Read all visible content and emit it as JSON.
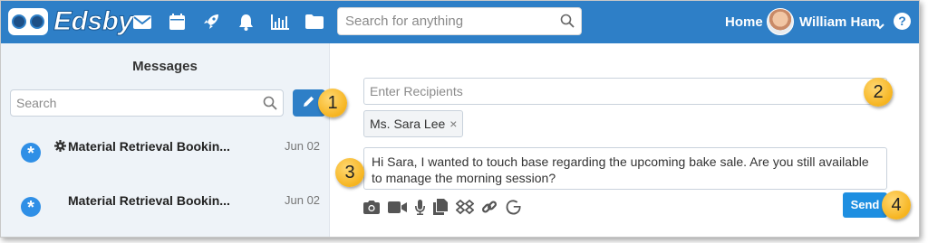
{
  "topbar": {
    "brand": "Edsby",
    "search_placeholder": "Search for anything",
    "home_label": "Home",
    "user_name": "William Ham",
    "help_glyph": "?"
  },
  "nav_icons": [
    "mail-icon",
    "calendar-icon",
    "rocket-icon",
    "bell-icon",
    "chart-icon",
    "folder-icon"
  ],
  "messages_panel": {
    "title": "Messages",
    "search_placeholder": "Search",
    "items": [
      {
        "subject": "Material Retrieval Bookin...",
        "date": "Jun 02",
        "has_gear": true
      },
      {
        "subject": "Material Retrieval Bookin...",
        "date": "Jun 02",
        "has_gear": false
      }
    ]
  },
  "compose": {
    "recipients_placeholder": "Enter Recipients",
    "recipient_chip": "Ms. Sara Lee",
    "chip_remove": "×",
    "body": "Hi Sara, I wanted to touch base regarding the upcoming bake sale. Are you still available to manage the morning session?",
    "toolbar_icons": [
      "camera-icon",
      "video-icon",
      "microphone-icon",
      "document-icon",
      "dropbox-icon",
      "link-icon",
      "google-icon"
    ],
    "send_label": "Send"
  },
  "callouts": [
    "1",
    "2",
    "3",
    "4"
  ],
  "colors": {
    "topbar": "#2e7fc7",
    "left_panel": "#eef3f8",
    "send_button": "#1e8fe1",
    "callout": "#f6b41f"
  }
}
